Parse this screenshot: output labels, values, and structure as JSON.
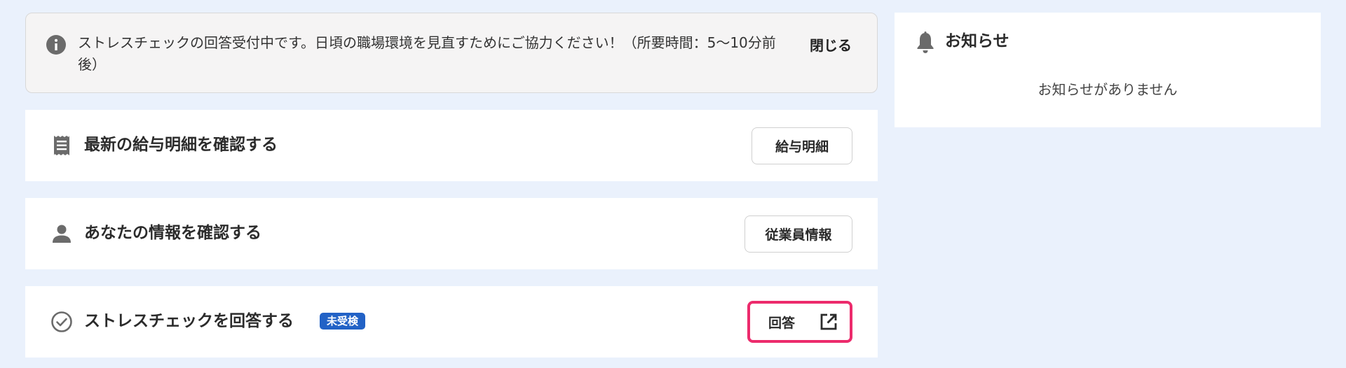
{
  "notice": {
    "message": "ストレスチェックの回答受付中です。日頃の職場環境を見直すためにご協力ください！（所要時間：5〜10分前後）",
    "close_label": "閉じる",
    "icon": "info-icon"
  },
  "cards": [
    {
      "title": "最新の給与明細を確認する",
      "button_label": "給与明細",
      "icon": "receipt-icon"
    },
    {
      "title": "あなたの情報を確認する",
      "button_label": "従業員情報",
      "icon": "person-icon"
    },
    {
      "title": "ストレスチェックを回答する",
      "badge": "未受検",
      "button_label": "回答",
      "icon": "check-circle-icon",
      "button_icon": "external-link-icon"
    }
  ],
  "news": {
    "title": "お知らせ",
    "empty_message": "お知らせがありません",
    "icon": "bell-icon"
  },
  "colors": {
    "background": "#eaf1fc",
    "badge": "#2262c6",
    "highlight_border": "#ec2b6c",
    "icon_gray": "#6b6b6b"
  }
}
